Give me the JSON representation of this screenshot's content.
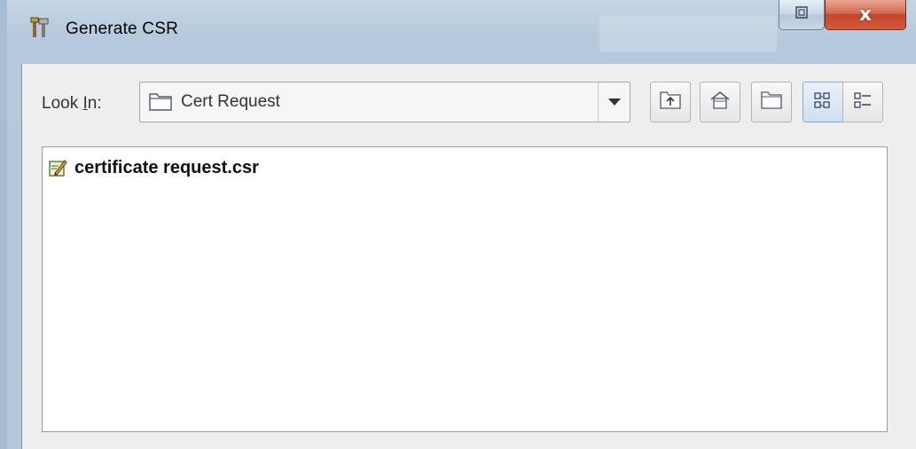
{
  "window": {
    "title": "Generate CSR",
    "close_glyph": "x",
    "icons": {
      "app": "tools-icon",
      "restore": "restore-icon",
      "close": "close-icon"
    }
  },
  "look_in": {
    "label_before": "Look ",
    "label_mnemonic": "I",
    "label_after": "n:",
    "selected": "Cert Request",
    "icon": "folder-icon"
  },
  "toolbar": {
    "buttons": [
      {
        "name": "up-one-level",
        "icon": "up-folder-icon"
      },
      {
        "name": "home",
        "icon": "home-icon"
      },
      {
        "name": "create-new-folder",
        "icon": "new-folder-icon"
      },
      {
        "name": "list-view",
        "icon": "list-view-icon",
        "pressed": true
      },
      {
        "name": "details-view",
        "icon": "details-view-icon",
        "pressed": false
      }
    ]
  },
  "files": [
    {
      "name": "certificate request.csr",
      "icon": "csr-file-icon"
    }
  ],
  "colors": {
    "frame": "#b7cadd",
    "client": "#eeeeee",
    "close_button": "#c5452a"
  }
}
